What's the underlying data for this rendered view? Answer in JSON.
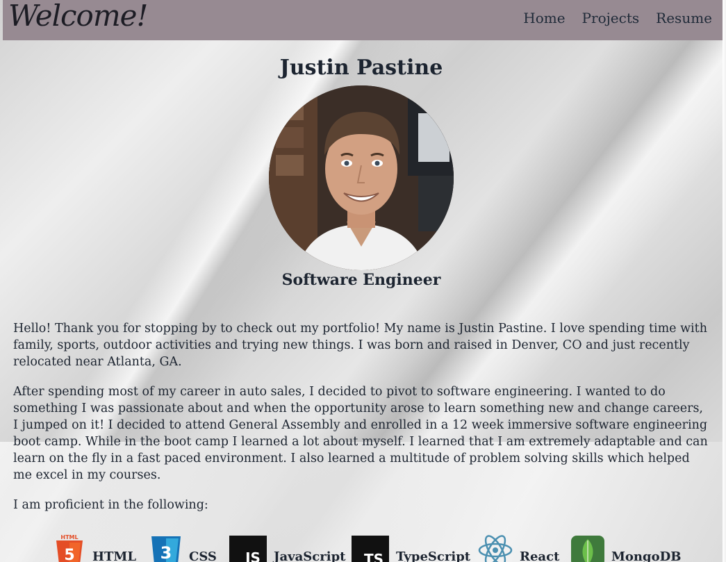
{
  "nav": {
    "logo": "Welcome!",
    "links": [
      "Home",
      "Projects",
      "Resume"
    ]
  },
  "profile": {
    "name": "Justin Pastine",
    "title": "Software Engineer",
    "photo_alt": "Justin Pastine portrait"
  },
  "bio": {
    "paragraph1": "Hello! Thank you for stopping by to check out my portfolio! My name is Justin Pastine. I love spending time with family, sports, outdoor activities and trying new things. I was born and raised in Denver, CO and just recently relocated near Atlanta, GA.",
    "paragraph2": "After spending most of my career in auto sales, I decided to pivot to software engineering. I wanted to do something I was passionate about and when the opportunity arose to learn something new and change careers, I jumped on it! I decided to attend General Assembly and enrolled in a 12 week immersive software engineering boot camp. While in the boot camp I learned a lot about myself. I learned that I am extremely adaptable and can learn on the fly in a fast paced environment. I also learned a multitude of problem solving skills which helped me excel in my courses.",
    "proficient_intro": "I am proficient in the following:"
  },
  "skills": [
    {
      "label": "HTML",
      "icon": "html5-icon",
      "color": "#e44d26",
      "icon_text": "5"
    },
    {
      "label": "CSS",
      "icon": "css3-icon",
      "color": "#1572b6",
      "icon_text": "3"
    },
    {
      "label": "JavaScript",
      "icon": "javascript-icon",
      "color": "#111111",
      "icon_text": "JS"
    },
    {
      "label": "TypeScript",
      "icon": "typescript-icon",
      "color": "#111111",
      "icon_text": "TS"
    },
    {
      "label": "React",
      "icon": "react-icon",
      "color": "#4a8fb0",
      "icon_text": ""
    },
    {
      "label": "MongoDB",
      "icon": "mongodb-icon",
      "color": "#4fa94d",
      "icon_text": ""
    }
  ],
  "colors": {
    "navbar": "#978a92",
    "text": "#1c2430"
  }
}
